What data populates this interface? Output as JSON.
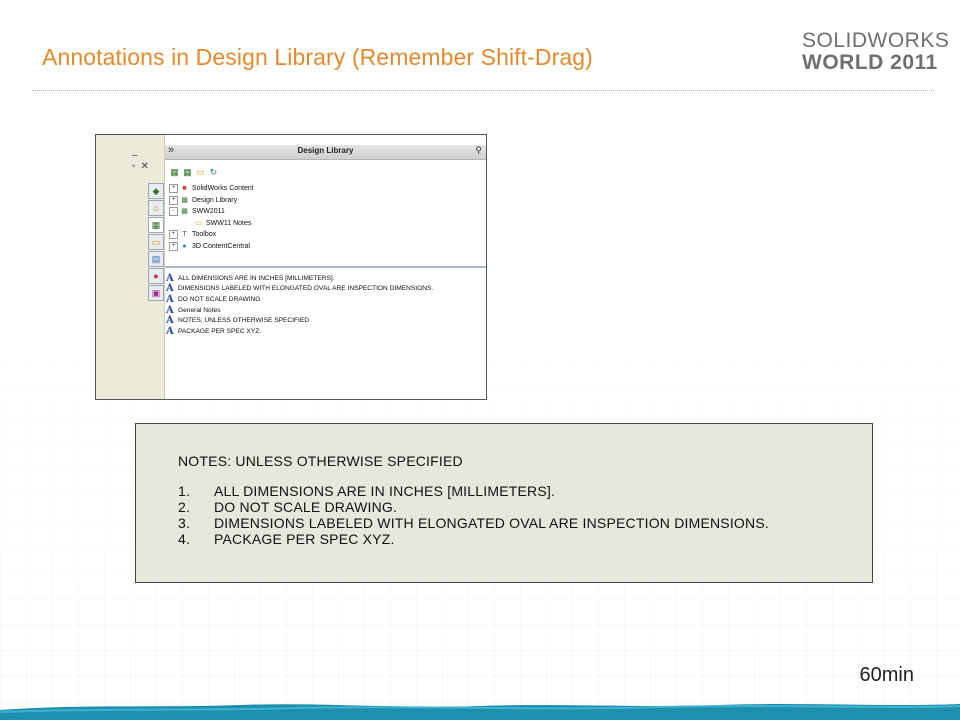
{
  "slide": {
    "title": "Annotations in Design Library (Remember Shift-Drag)",
    "brand_line1": "SOLIDWORKS",
    "brand_line2": "WORLD 2011",
    "time": "60min"
  },
  "design_library": {
    "header": "Design Library",
    "tree": [
      {
        "label": "SolidWorks Content",
        "icon": "solidworks-content-icon",
        "expander": "+"
      },
      {
        "label": "Design Library",
        "icon": "library-icon",
        "expander": "+"
      },
      {
        "label": "SWW2011",
        "icon": "library-icon",
        "expander": "-"
      },
      {
        "label": "SWW11 Notes",
        "icon": "folder-icon",
        "expander": ""
      },
      {
        "label": "Toolbox",
        "icon": "toolbox-icon",
        "expander": "+"
      },
      {
        "label": "3D ContentCentral",
        "icon": "globe-icon",
        "expander": "+"
      }
    ],
    "notes": [
      "ALL DIMENSIONS ARE IN INCHES [MILLIMETERS].",
      "DIMENSIONS LABELED WITH ELONGATED OVAL ARE INSPECTION DIMENSIONS.",
      "DO NOT SCALE DRAWING",
      "General Notes",
      "NOTES; UNLESS OTHERWISE SPECIFIED",
      "PACKAGE PER SPEC XYZ."
    ]
  },
  "notes_box": {
    "heading": "NOTES: UNLESS OTHERWISE SPECIFIED",
    "items": [
      {
        "num": "1.",
        "text": "ALL DIMENSIONS ARE IN INCHES [MILLIMETERS]."
      },
      {
        "num": "2.",
        "text": "DO NOT SCALE DRAWING."
      },
      {
        "num": "3.",
        "text": "DIMENSIONS LABELED WITH ELONGATED OVAL ARE INSPECTION DIMENSIONS."
      },
      {
        "num": "4.",
        "text": "PACKAGE PER SPEC XYZ."
      }
    ]
  },
  "colors": {
    "title": "#e38a2c",
    "brand": "#6f6f72",
    "wave": "#1f8fae",
    "note_icon": "#2d4fa8"
  }
}
